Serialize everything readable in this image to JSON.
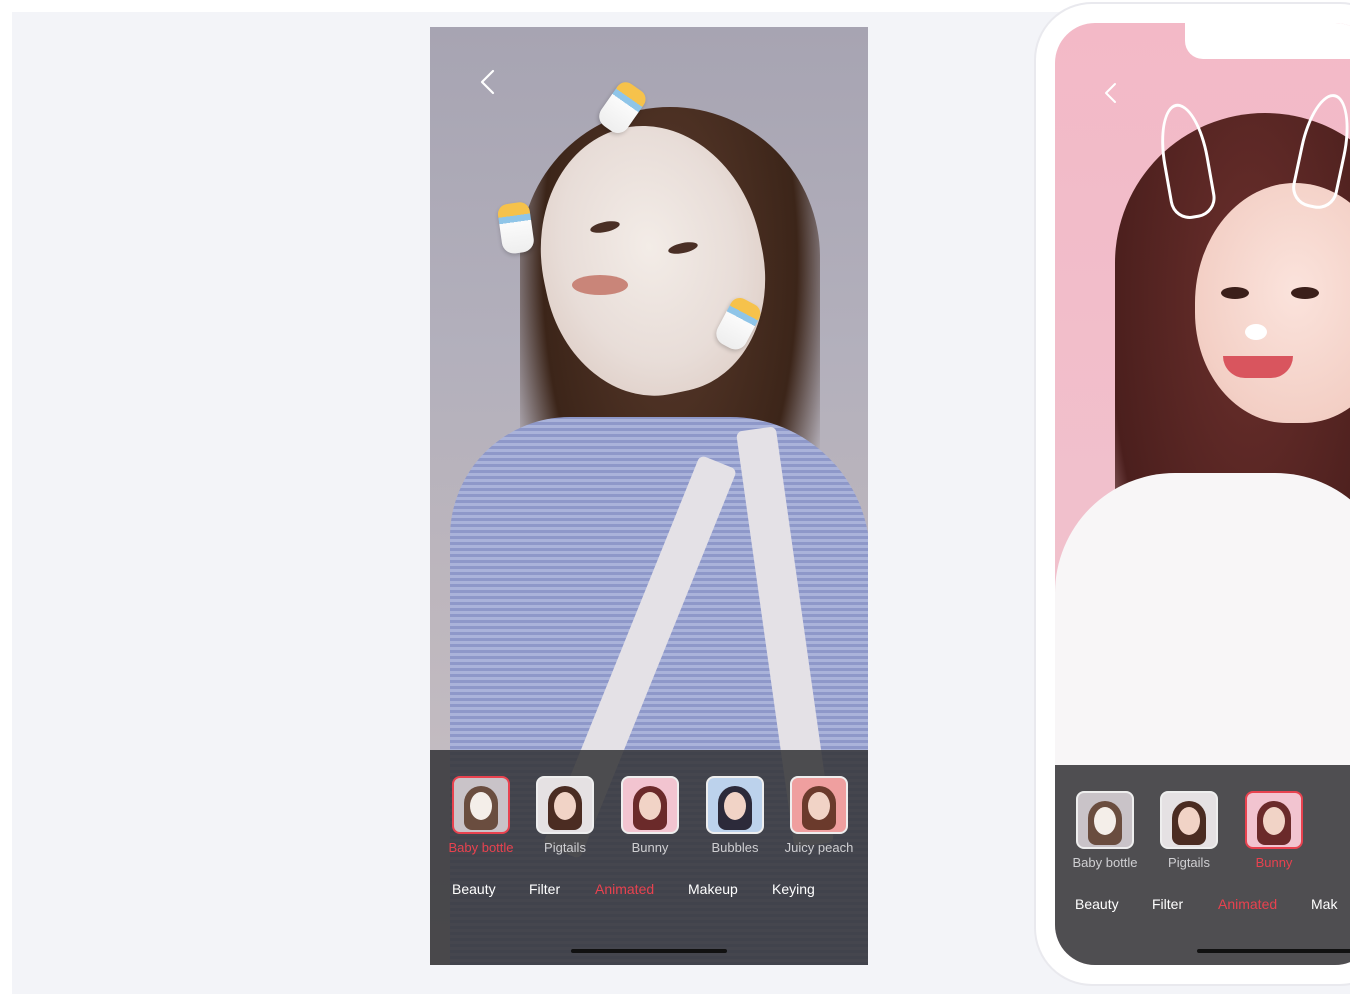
{
  "screen_left": {
    "back_icon": "chevron-left-icon",
    "stickers": [
      {
        "label": "Baby bottle",
        "selected": true
      },
      {
        "label": "Pigtails",
        "selected": false
      },
      {
        "label": "Bunny",
        "selected": false
      },
      {
        "label": "Bubbles",
        "selected": false
      },
      {
        "label": "Juicy peach",
        "selected": false
      }
    ],
    "tabs": [
      {
        "label": "Beauty",
        "active": false
      },
      {
        "label": "Filter",
        "active": false
      },
      {
        "label": "Animated",
        "active": true
      },
      {
        "label": "Makeup",
        "active": false
      },
      {
        "label": "Keying",
        "active": false
      }
    ]
  },
  "screen_right": {
    "back_icon": "chevron-left-icon",
    "stickers": [
      {
        "label": "Baby bottle",
        "selected": false
      },
      {
        "label": "Pigtails",
        "selected": false
      },
      {
        "label": "Bunny",
        "selected": true
      }
    ],
    "tabs": [
      {
        "label": "Beauty",
        "active": false
      },
      {
        "label": "Filter",
        "active": false
      },
      {
        "label": "Animated",
        "active": true
      },
      {
        "label": "Mak",
        "active": false
      }
    ]
  },
  "colors": {
    "accent": "#e8424f",
    "panel": "#37373a",
    "background": "#f3f4f8"
  }
}
